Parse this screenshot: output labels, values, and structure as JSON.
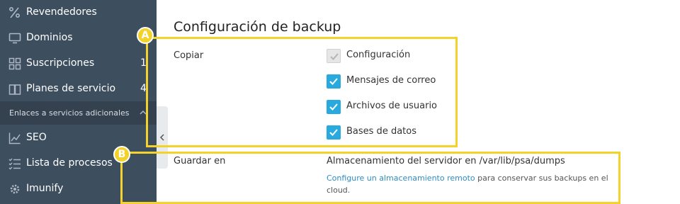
{
  "sidebar": {
    "items": [
      {
        "label": "Revendedores",
        "icon": "percent-icon",
        "count": ""
      },
      {
        "label": "Dominios",
        "icon": "monitor-icon",
        "count": ""
      },
      {
        "label": "Suscripciones",
        "icon": "grid-icon",
        "count": "1"
      },
      {
        "label": "Planes de servicio",
        "icon": "book-icon",
        "count": "4"
      }
    ],
    "section_title": "Enlaces a servicios adicionales",
    "section_items": [
      {
        "label": "SEO",
        "icon": "chart-icon"
      },
      {
        "label": "Lista de procesos",
        "icon": "checklist-icon"
      },
      {
        "label": "Imunify",
        "icon": "gear-icon"
      }
    ]
  },
  "main": {
    "title": "Configuración de backup",
    "copy_label": "Copiar",
    "checkboxes": [
      {
        "label": "Configuración",
        "checked": true,
        "disabled": true
      },
      {
        "label": "Mensajes de correo",
        "checked": true,
        "disabled": false
      },
      {
        "label": "Archivos de usuario",
        "checked": true,
        "disabled": false
      },
      {
        "label": "Bases de datos",
        "checked": true,
        "disabled": false
      }
    ],
    "save_label": "Guardar en",
    "storage_text": "Almacenamiento del servidor en /var/lib/psa/dumps",
    "hint_link": "Configure un almacenamiento remoto",
    "hint_text": " para conservar sus backups en el cloud."
  },
  "annotations": {
    "a": "A",
    "b": "B"
  },
  "colors": {
    "sidebar": "#3d4e5f",
    "accent": "#28aade",
    "annotation": "#f2d22b",
    "link": "#2b8dc4"
  }
}
